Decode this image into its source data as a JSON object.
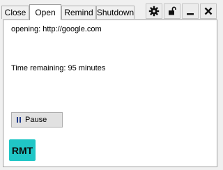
{
  "tabs": [
    {
      "label": "Close",
      "active": false
    },
    {
      "label": "Open",
      "active": true
    },
    {
      "label": "Remind",
      "active": false
    },
    {
      "label": "Shutdown",
      "active": false
    }
  ],
  "toolbar": {
    "icons": [
      "gear-icon",
      "unlock-icon",
      "minimize-icon",
      "close-icon"
    ]
  },
  "main": {
    "opening_text": "opening: http://google.com",
    "time_remaining_text": "Time remaining: 95 minutes",
    "pause_label": "Pause",
    "logo_text": "RMT"
  },
  "colors": {
    "logo_background": "#20c6c6",
    "pause_icon": "#1f3a8a"
  }
}
